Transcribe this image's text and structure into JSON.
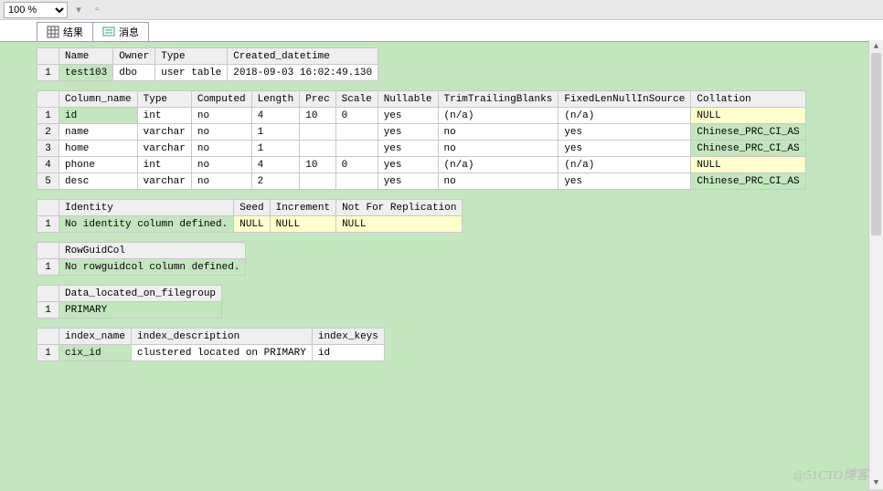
{
  "toolbar": {
    "zoom": "100 %"
  },
  "tabs": {
    "results": "结果",
    "messages": "消息"
  },
  "watermark": "@51CTO博客",
  "table1": {
    "headers": [
      "",
      "Name",
      "Owner",
      "Type",
      "Created_datetime"
    ],
    "rows": [
      {
        "n": "1",
        "name": "test103",
        "owner": "dbo",
        "type": "user table",
        "created": "2018-09-03 16:02:49.130"
      }
    ]
  },
  "table2": {
    "headers": [
      "",
      "Column_name",
      "Type",
      "Computed",
      "Length",
      "Prec",
      "Scale",
      "Nullable",
      "TrimTrailingBlanks",
      "FixedLenNullInSource",
      "Collation"
    ],
    "rows": [
      {
        "n": "1",
        "col": "id",
        "type": "int",
        "comp": "no",
        "len": "4",
        "prec": "10",
        "scale": "0",
        "null": "yes",
        "trim": "(n/a)",
        "fixed": "(n/a)",
        "coll": "NULL",
        "coll_cls": "hl-yellow",
        "col_cls": "hl-green"
      },
      {
        "n": "2",
        "col": "name",
        "type": "varchar",
        "comp": "no",
        "len": "1",
        "prec": "",
        "scale": "",
        "null": "yes",
        "trim": "no",
        "fixed": "yes",
        "coll": "Chinese_PRC_CI_AS",
        "coll_cls": "hl-green",
        "col_cls": ""
      },
      {
        "n": "3",
        "col": "home",
        "type": "varchar",
        "comp": "no",
        "len": "1",
        "prec": "",
        "scale": "",
        "null": "yes",
        "trim": "no",
        "fixed": "yes",
        "coll": "Chinese_PRC_CI_AS",
        "coll_cls": "hl-green",
        "col_cls": ""
      },
      {
        "n": "4",
        "col": "phone",
        "type": "int",
        "comp": "no",
        "len": "4",
        "prec": "10",
        "scale": "0",
        "null": "yes",
        "trim": "(n/a)",
        "fixed": "(n/a)",
        "coll": "NULL",
        "coll_cls": "hl-yellow",
        "col_cls": ""
      },
      {
        "n": "5",
        "col": "desc",
        "type": "varchar",
        "comp": "no",
        "len": "2",
        "prec": "",
        "scale": "",
        "null": "yes",
        "trim": "no",
        "fixed": "yes",
        "coll": "Chinese_PRC_CI_AS",
        "coll_cls": "hl-green",
        "col_cls": ""
      }
    ]
  },
  "table3": {
    "headers": [
      "",
      "Identity",
      "Seed",
      "Increment",
      "Not For Replication"
    ],
    "rows": [
      {
        "n": "1",
        "identity": "No identity column defined.",
        "seed": "NULL",
        "inc": "NULL",
        "nfr": "NULL"
      }
    ]
  },
  "table4": {
    "headers": [
      "",
      "RowGuidCol"
    ],
    "rows": [
      {
        "n": "1",
        "rgc": "No rowguidcol column defined."
      }
    ]
  },
  "table5": {
    "headers": [
      "",
      "Data_located_on_filegroup"
    ],
    "rows": [
      {
        "n": "1",
        "fg": "PRIMARY"
      }
    ]
  },
  "table6": {
    "headers": [
      "",
      "index_name",
      "index_description",
      "index_keys"
    ],
    "rows": [
      {
        "n": "1",
        "name": "cix_id",
        "desc": "clustered located on PRIMARY",
        "keys": "id"
      }
    ]
  }
}
